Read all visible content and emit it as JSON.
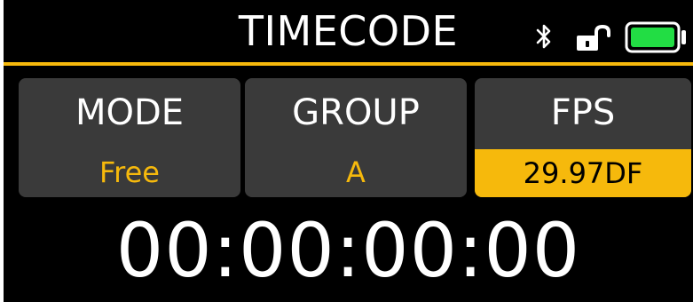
{
  "header": {
    "title": "TIMECODE",
    "bluetooth_icon": "bluetooth-icon",
    "lock_icon": "unlocked-padlock-icon",
    "battery_icon": "battery-full-icon",
    "battery_level": 1.0
  },
  "settings": {
    "mode": {
      "label": "MODE",
      "value": "Free"
    },
    "group": {
      "label": "GROUP",
      "value": "A"
    },
    "fps": {
      "label": "FPS",
      "value": "29.97DF",
      "selected": true
    }
  },
  "timecode": {
    "value": "00:00:00:00"
  },
  "colors": {
    "accent": "#f6b90c",
    "tile": "#3a3a3a",
    "battery": "#22dd44",
    "background": "#000000",
    "text": "#ffffff"
  }
}
